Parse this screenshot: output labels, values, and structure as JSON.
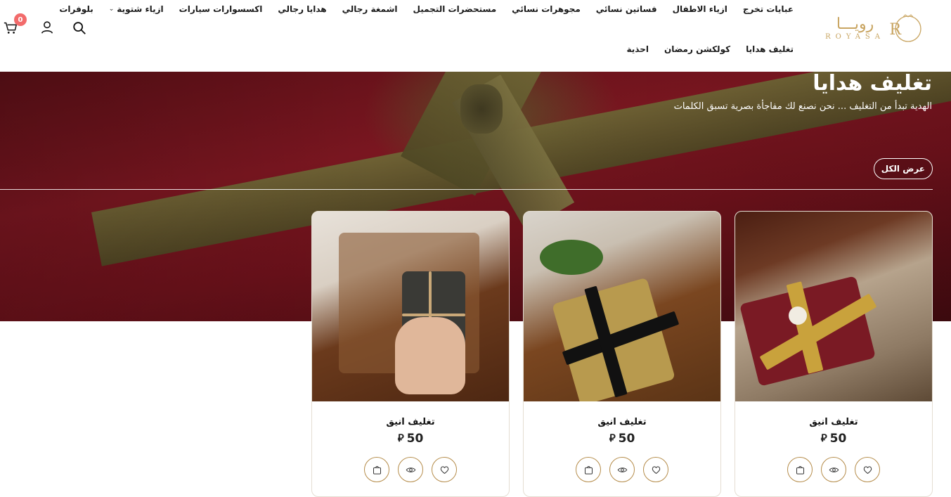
{
  "brand": {
    "name_ar": "رويـــا",
    "name_en": "ROYASA"
  },
  "nav": {
    "row1": [
      "عبايات تخرج",
      "ازياء الاطفال",
      "فساتين نسائي",
      "مجوهرات نسائي",
      "مستحضرات التجميل",
      "اشمغة رجالي",
      "هدايا رجالي",
      "اكسسوارات سيارات",
      "ازياء شتوية",
      "بلوفرات"
    ],
    "row2": [
      "تغليف هدايا",
      "كولكشن رمضان",
      "احذية"
    ],
    "dropdown_item_index": 8
  },
  "header_icons": {
    "search": "search-icon",
    "account": "user-icon",
    "cart": "cart-icon",
    "cart_count": "0"
  },
  "hero": {
    "title": "تغليف هدايا",
    "subtitle": "الهدية تبدأ من التغليف ... نحن نصنع لك مفاجأة بصرية تسبق الكلمات",
    "view_all": "عرض الكل"
  },
  "products": [
    {
      "name": "تغليف انيق",
      "price": "50",
      "currency": "⃁"
    },
    {
      "name": "تغليف انيق",
      "price": "50",
      "currency": "⃁"
    },
    {
      "name": "تغليف انيق",
      "price": "50",
      "currency": "⃁"
    }
  ],
  "colors": {
    "accent": "#b58c4a",
    "badge": "#f26b6b",
    "hero_red": "#7a1620",
    "ribbon": "#6e6535"
  }
}
